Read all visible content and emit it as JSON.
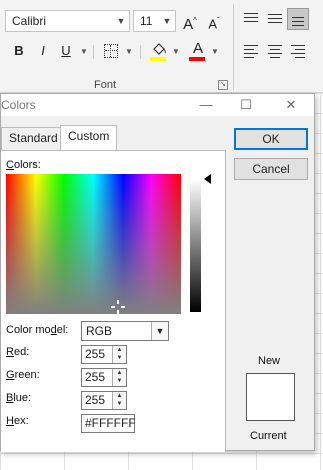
{
  "ribbon": {
    "font_name": "Calibri",
    "font_size": "11",
    "grow_font": "A",
    "shrink_font": "A",
    "bold": "B",
    "italic": "I",
    "underline": "U",
    "font_color_glyph": "A",
    "group_label": "Font",
    "font_color": "#ff0000",
    "highlight_color": "#ffff00"
  },
  "dialog": {
    "title": "Colors",
    "tabs": [
      "Standard",
      "Custom"
    ],
    "active_tab": "Custom",
    "colors_label_u": "C",
    "colors_label_rest": "olors:",
    "ok": "OK",
    "cancel": "Cancel",
    "color_model_label": "Color mo",
    "color_model_label_u": "d",
    "color_model_label_rest": "el:",
    "color_model": "RGB",
    "red_u": "R",
    "red_rest": "ed:",
    "red": "255",
    "green_u": "G",
    "green_rest": "reen:",
    "green": "255",
    "blue_u": "B",
    "blue_rest": "lue:",
    "blue": "255",
    "hex_u": "H",
    "hex_rest": "ex:",
    "hex": "#FFFFFF",
    "new_label": "New",
    "current_label": "Current",
    "preview_color": "#ffffff"
  }
}
